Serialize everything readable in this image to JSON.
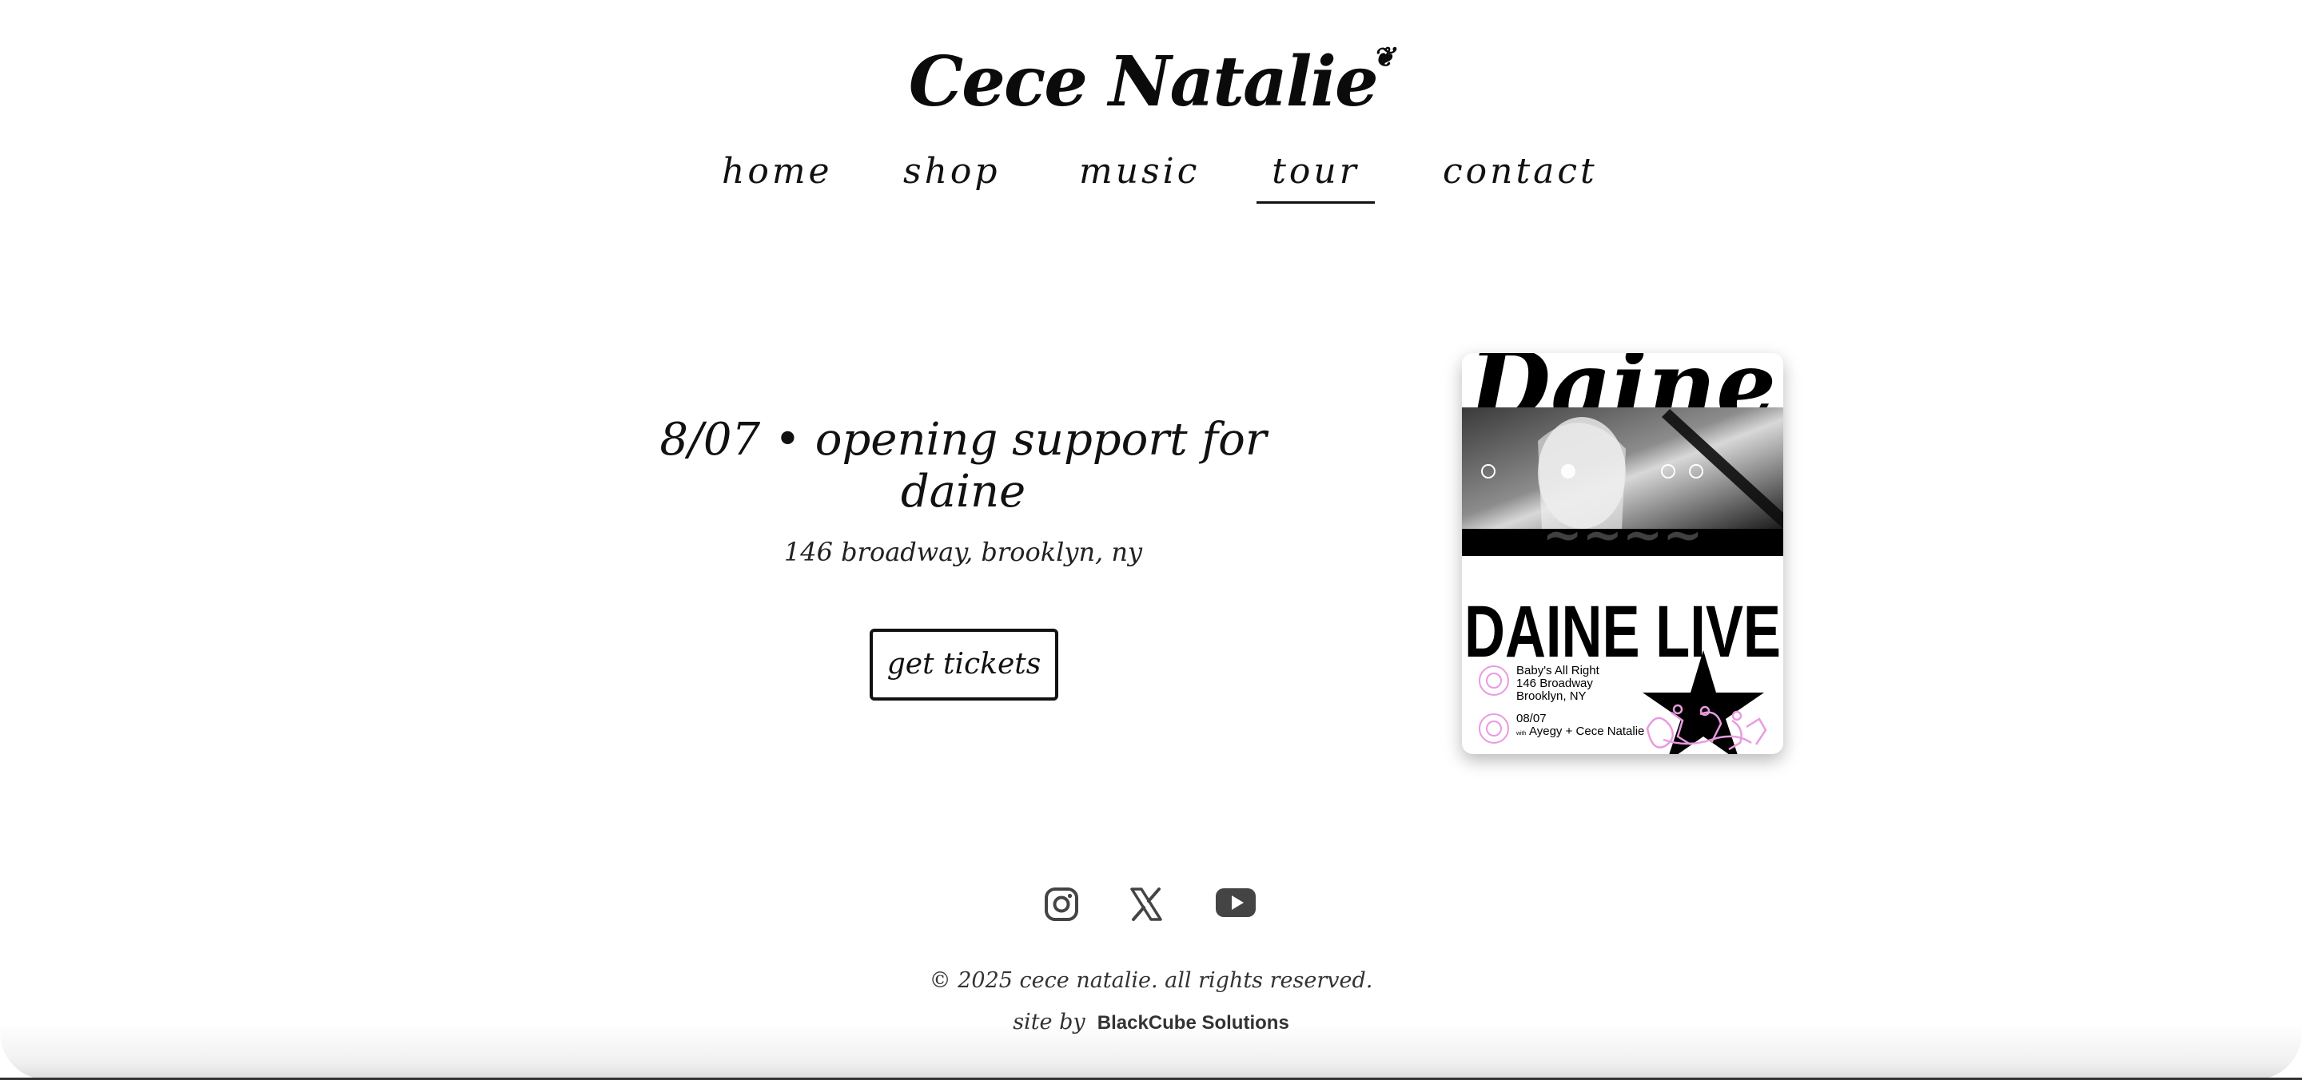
{
  "brand": {
    "name": "Cece Natalie",
    "logo_icon": "leaf-icon"
  },
  "nav": {
    "items": [
      {
        "label": "home"
      },
      {
        "label": "shop"
      },
      {
        "label": "music"
      },
      {
        "label": "tour"
      },
      {
        "label": "contact"
      }
    ],
    "active": "tour"
  },
  "event": {
    "headline": "8/07 • opening support for daine",
    "address": "146 broadway, brooklyn, ny",
    "tickets_label": "get tickets"
  },
  "poster": {
    "top_title": "Daine",
    "title": "DAINE LIVE",
    "venue": [
      "Baby's All Right",
      "146 Broadway",
      "Brooklyn, NY"
    ],
    "date": "08/07",
    "with_prefix": "with",
    "with_acts": "Ayegy + Cece Natalie",
    "accent_color": "#e89be0"
  },
  "social": {
    "icons": [
      "instagram-icon",
      "x-icon",
      "youtube-icon"
    ]
  },
  "footer": {
    "copyright": "© 2025 cece natalie. all rights reserved.",
    "credit_prefix": "site by",
    "credit_link": "BlackCube Solutions"
  }
}
